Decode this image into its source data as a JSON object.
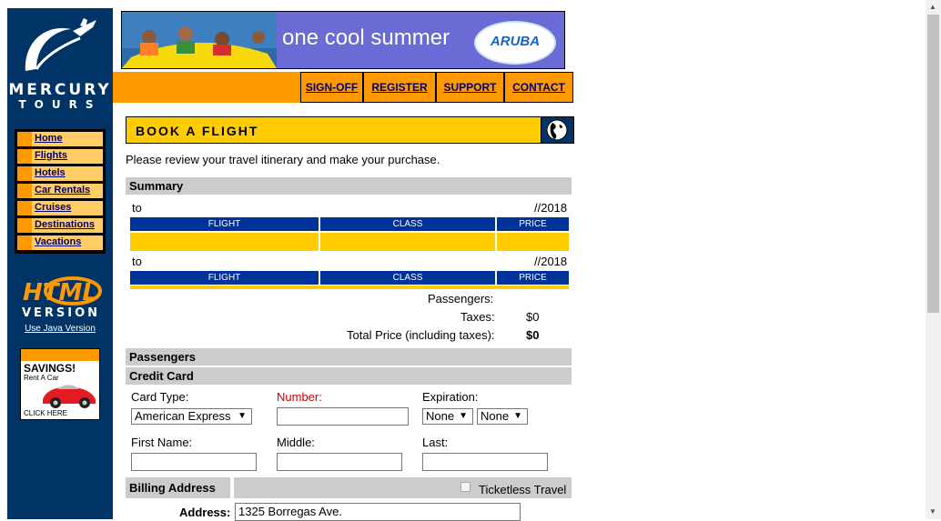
{
  "brand": {
    "word1": "MERCURY",
    "word2": "TOURS"
  },
  "nav": [
    {
      "label": "Home"
    },
    {
      "label": "Flights"
    },
    {
      "label": "Hotels"
    },
    {
      "label": "Car Rentals"
    },
    {
      "label": "Cruises"
    },
    {
      "label": "Destinations"
    },
    {
      "label": "Vacations"
    }
  ],
  "badge": {
    "line1": "HTML",
    "line2": "VERSION"
  },
  "java_link": "Use Java Version",
  "ad": {
    "title": "SAVINGS!",
    "sub": "Rent A Car",
    "click": "CLICK HERE"
  },
  "banner": {
    "text": "one cool summer",
    "logo": "ARUBA"
  },
  "top_links": [
    "SIGN-OFF",
    "REGISTER",
    "SUPPORT",
    "CONTACT"
  ],
  "page": {
    "title": "BOOK A FLIGHT",
    "intro": "Please review your travel itinerary and make your purchase."
  },
  "summary": {
    "header": "Summary",
    "depart": {
      "route": "to",
      "date": "//2018"
    },
    "return": {
      "route": "to",
      "date": "//2018"
    },
    "columns": [
      "FLIGHT",
      "CLASS",
      "PRICE"
    ],
    "passengers_label": "Passengers:",
    "taxes_label": "Taxes:",
    "taxes_value": "$0",
    "total_label": "Total Price (including taxes):",
    "total_value": "$0"
  },
  "passengers": {
    "header": "Passengers"
  },
  "credit_card": {
    "header": "Credit Card",
    "card_type_label": "Card Type:",
    "card_type_value": "American Express",
    "number_label": "Number:",
    "expiration_label": "Expiration:",
    "exp_month": "None",
    "exp_year": "None",
    "first_label": "First Name:",
    "middle_label": "Middle:",
    "last_label": "Last:"
  },
  "billing": {
    "header": "Billing Address",
    "ticketless": "Ticketless Travel",
    "address_label": "Address:",
    "address_value": "1325 Borregas Ave."
  },
  "colors": {
    "navy": "#003366",
    "orange": "#ff9900",
    "yellow": "#ffcc00",
    "blue": "#003399"
  }
}
